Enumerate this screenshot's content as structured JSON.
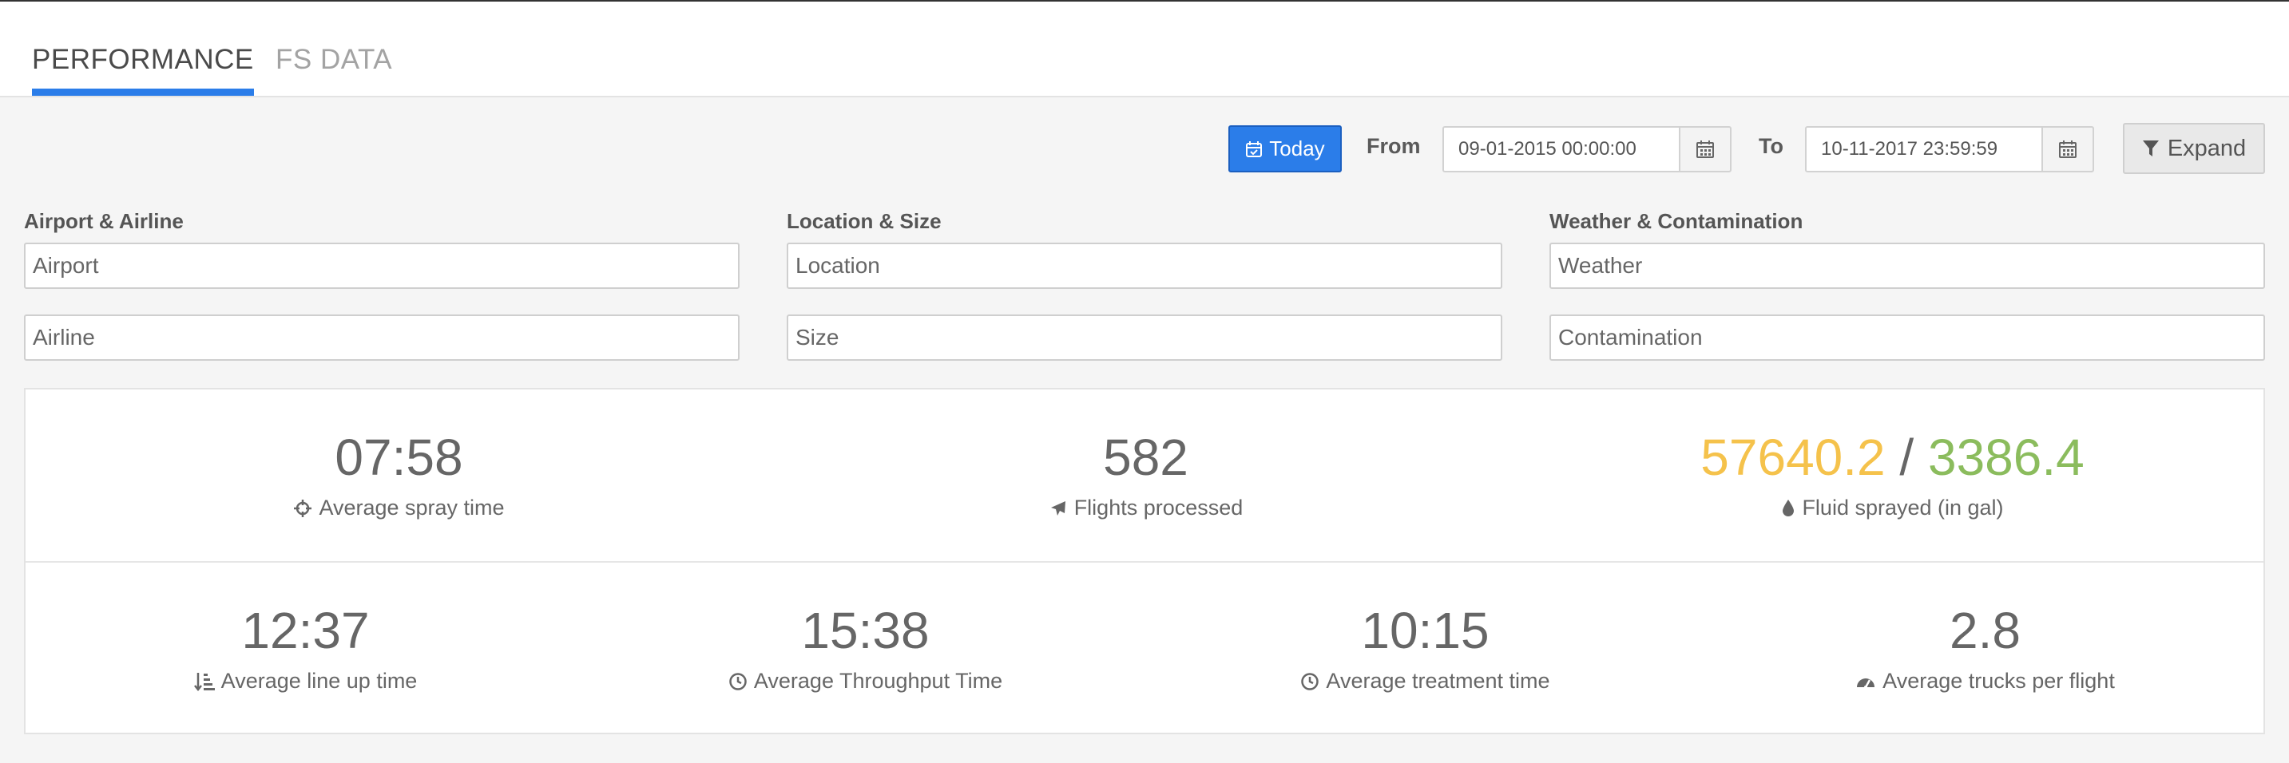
{
  "tabs": [
    {
      "label": "PERFORMANCE",
      "active": true
    },
    {
      "label": "FS DATA",
      "active": false
    }
  ],
  "filters": {
    "today_label": "Today",
    "from_label": "From",
    "from_value": "09-01-2015 00:00:00",
    "to_label": "To",
    "to_value": "10-11-2017 23:59:59",
    "expand_label": "Expand"
  },
  "groups": {
    "airport_airline": {
      "title": "Airport & Airline",
      "placeholder_1": "Airport",
      "placeholder_2": "Airline"
    },
    "location_size": {
      "title": "Location & Size",
      "placeholder_1": "Location",
      "placeholder_2": "Size"
    },
    "weather_contamination": {
      "title": "Weather & Contamination",
      "placeholder_1": "Weather",
      "placeholder_2": "Contamination"
    }
  },
  "stats": {
    "spray_time": {
      "value": "07:58",
      "label": "Average spray time",
      "icon": "crosshairs-icon"
    },
    "flights": {
      "value": "582",
      "label": "Flights processed",
      "icon": "plane-icon"
    },
    "fluid": {
      "value_a": "57640.2",
      "separator": "/",
      "value_b": "3386.4",
      "label": "Fluid sprayed (in gal)",
      "icon": "droplet-icon"
    },
    "line_up": {
      "value": "12:37",
      "label": "Average line up time",
      "icon": "sort-amount-icon"
    },
    "throughput": {
      "value": "15:38",
      "label": "Average Throughput Time",
      "icon": "clock-icon"
    },
    "treatment": {
      "value": "10:15",
      "label": "Average treatment time",
      "icon": "clock-icon"
    },
    "trucks": {
      "value": "2.8",
      "label": "Average trucks per flight",
      "icon": "dashboard-icon"
    }
  },
  "colors": {
    "accent": "#2b7de9",
    "fluid_a": "#f5c24b",
    "fluid_b": "#8bbc5d",
    "background": "#f5f5f5"
  }
}
